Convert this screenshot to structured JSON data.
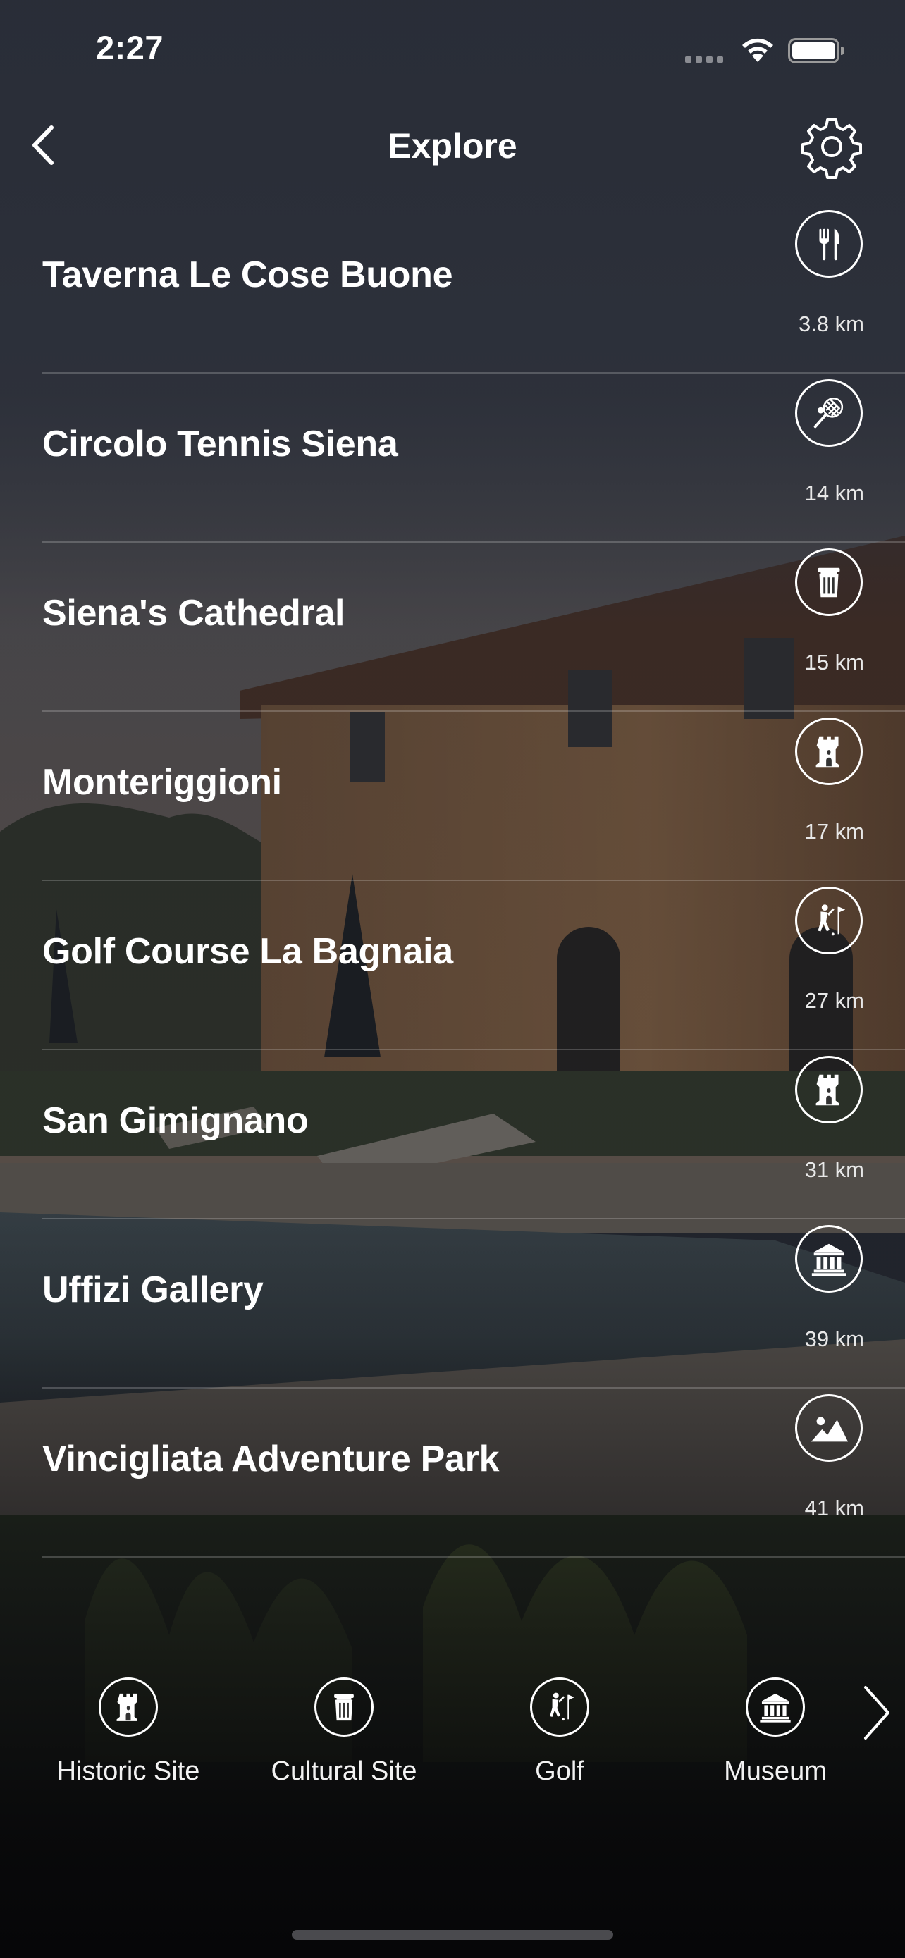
{
  "status_bar": {
    "time": "2:27",
    "icons": [
      "cellular-signal-icon",
      "wifi-icon",
      "battery-icon"
    ]
  },
  "nav": {
    "title": "Explore",
    "back_icon": "chevron-left-icon",
    "settings_icon": "gear-icon"
  },
  "places": [
    {
      "name": "Taverna Le Cose Buone",
      "distance": "3.8 km",
      "icon": "restaurant-icon"
    },
    {
      "name": "Circolo Tennis Siena",
      "distance": "14 km",
      "icon": "tennis-icon"
    },
    {
      "name": "Siena's Cathedral",
      "distance": "15 km",
      "icon": "cultural-site-icon"
    },
    {
      "name": "Monteriggioni",
      "distance": "17 km",
      "icon": "historic-site-icon"
    },
    {
      "name": "Golf Course La Bagnaia",
      "distance": "27 km",
      "icon": "golf-icon"
    },
    {
      "name": "San Gimignano",
      "distance": "31 km",
      "icon": "historic-site-icon"
    },
    {
      "name": "Uffizi Gallery",
      "distance": "39 km",
      "icon": "museum-icon"
    },
    {
      "name": "Vincigliata Adventure Park",
      "distance": "41 km",
      "icon": "landscape-icon"
    }
  ],
  "categories": [
    {
      "label": "Historic Site",
      "icon": "historic-site-icon"
    },
    {
      "label": "Cultural Site",
      "icon": "cultural-site-icon"
    },
    {
      "label": "Golf",
      "icon": "golf-icon"
    },
    {
      "label": "Museum",
      "icon": "museum-icon"
    }
  ],
  "category_next_icon": "chevron-right-icon",
  "colors": {
    "text": "#ffffff",
    "overlay": "#282c36",
    "divider": "rgba(255,255,255,0.2)"
  }
}
